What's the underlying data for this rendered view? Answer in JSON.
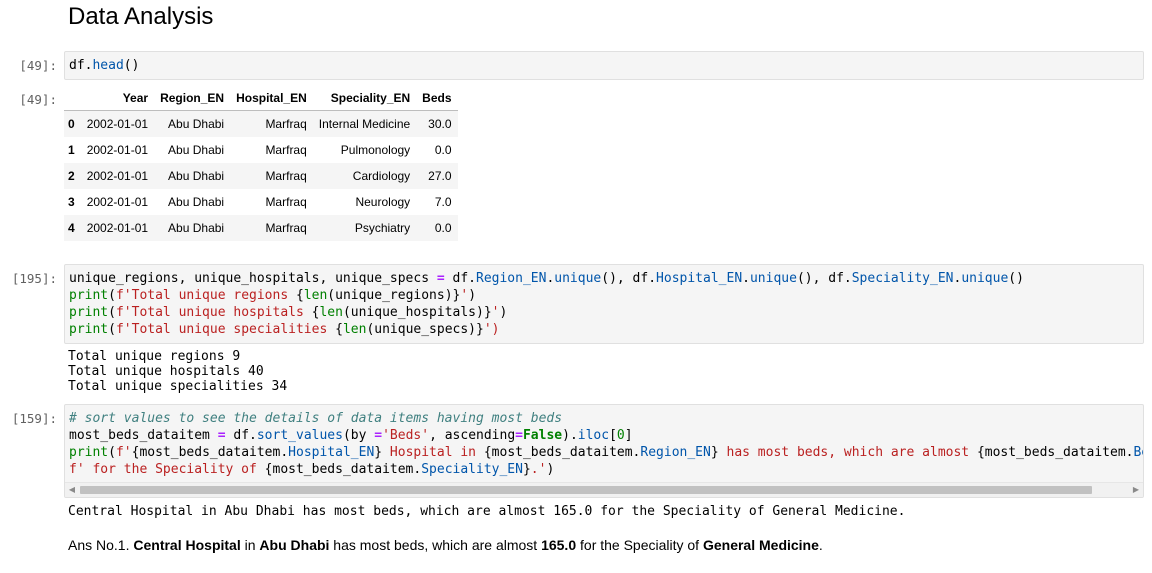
{
  "section": {
    "title": "Data Analysis"
  },
  "cells": {
    "c1": {
      "prompt": "[49]:",
      "code": "df.head()",
      "out_prompt": "[49]:",
      "table": {
        "columns": [
          "Year",
          "Region_EN",
          "Hospital_EN",
          "Speciality_EN",
          "Beds"
        ],
        "rows": [
          {
            "index": "0",
            "cells": [
              "2002-01-01",
              "Abu Dhabi",
              "Marfraq",
              "Internal Medicine",
              "30.0"
            ]
          },
          {
            "index": "1",
            "cells": [
              "2002-01-01",
              "Abu Dhabi",
              "Marfraq",
              "Pulmonology",
              "0.0"
            ]
          },
          {
            "index": "2",
            "cells": [
              "2002-01-01",
              "Abu Dhabi",
              "Marfraq",
              "Cardiology",
              "27.0"
            ]
          },
          {
            "index": "3",
            "cells": [
              "2002-01-01",
              "Abu Dhabi",
              "Marfraq",
              "Neurology",
              "7.0"
            ]
          },
          {
            "index": "4",
            "cells": [
              "2002-01-01",
              "Abu Dhabi",
              "Marfraq",
              "Psychiatry",
              "0.0"
            ]
          }
        ]
      }
    },
    "c2": {
      "prompt": "[195]:",
      "output": [
        "Total unique regions 9",
        "Total unique hospitals 40",
        "Total unique specialities 34"
      ]
    },
    "c3": {
      "prompt": "[159]:",
      "output": "Central Hospital in Abu Dhabi has most beds, which are almost 165.0 for the Speciality of General Medicine."
    }
  },
  "answer": {
    "prefix": "Ans No.1. ",
    "hospital": "Central Hospital",
    "in_text": " in ",
    "region": "Abu Dhabi",
    "mid_text": " has most beds, which are almost ",
    "beds": "165.0",
    "tail_text": " for the Speciality of ",
    "speciality": "General Medicine",
    "end": "."
  }
}
